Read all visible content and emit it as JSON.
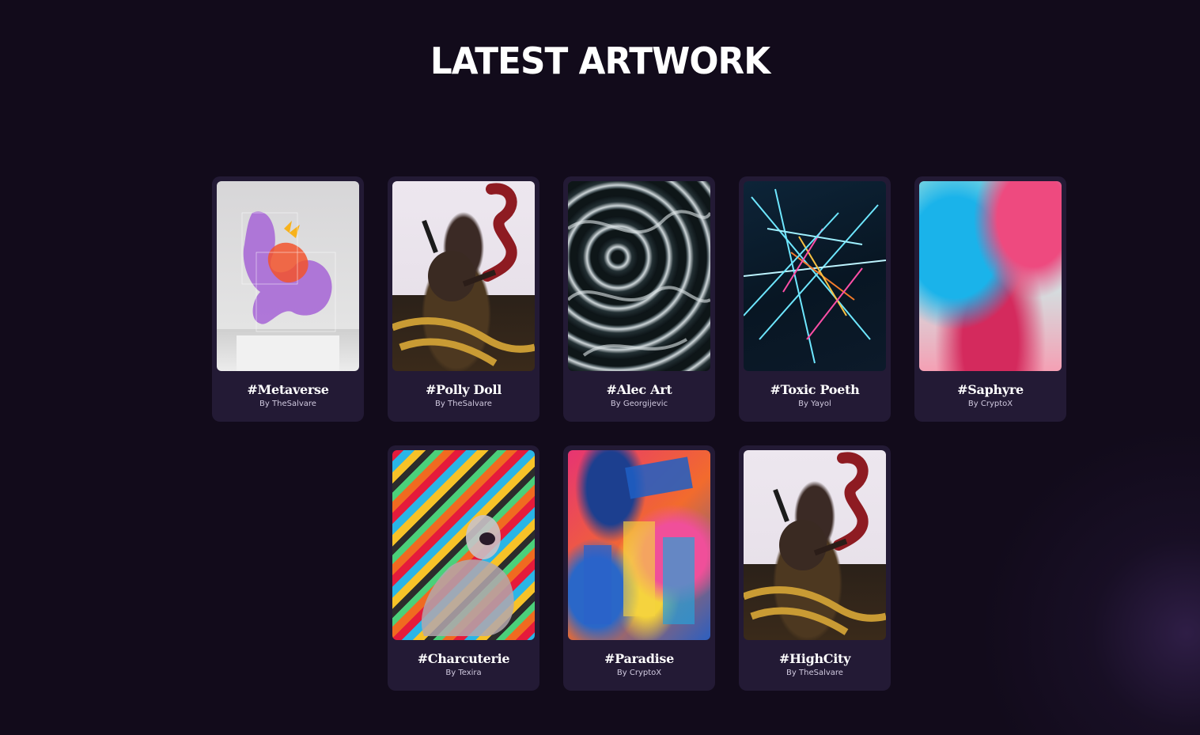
{
  "page": {
    "title": "LATEST ARTWORK"
  },
  "artworks": [
    {
      "title": "#Metaverse",
      "author": "By TheSalvare"
    },
    {
      "title": "#Polly Doll",
      "author": "By TheSalvare"
    },
    {
      "title": "#Alec Art",
      "author": "By Georgijevic"
    },
    {
      "title": "#Toxic Poeth",
      "author": "By Yayol"
    },
    {
      "title": "#Saphyre",
      "author": "By CryptoX"
    },
    {
      "title": "#Charcuterie",
      "author": "By Texira"
    },
    {
      "title": "#Paradise",
      "author": "By CryptoX"
    },
    {
      "title": "#HighCity",
      "author": "By TheSalvare"
    }
  ],
  "colors": {
    "background": "#120b1b",
    "card": "#231a35",
    "title_text": "#ffffff",
    "author_text": "#d0c9df"
  }
}
